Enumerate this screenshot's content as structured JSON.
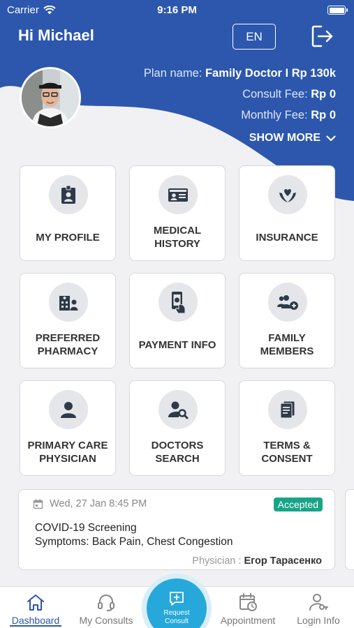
{
  "status_bar": {
    "carrier": "Carrier",
    "time": "9:16 PM"
  },
  "header": {
    "greeting": "Hi Michael",
    "language": "EN",
    "plan_name_label": "Plan name:",
    "plan_name_value": "Family Doctor I Rp 130k",
    "consult_fee_label": "Consult Fee:",
    "consult_fee_value": "Rp 0",
    "monthly_fee_label": "Monthly Fee:",
    "monthly_fee_value": "Rp 0",
    "show_more": "SHOW MORE"
  },
  "tiles": [
    {
      "label": "MY PROFILE",
      "icon": "id-badge-icon"
    },
    {
      "label": "MEDICAL HISTORY",
      "icon": "id-card-icon"
    },
    {
      "label": "INSURANCE",
      "icon": "hand-heart-icon"
    },
    {
      "label": "PREFERRED PHARMACY",
      "icon": "hospital-building-icon"
    },
    {
      "label": "PAYMENT INFO",
      "icon": "phone-payment-icon"
    },
    {
      "label": "FAMILY MEMBERS",
      "icon": "users-add-icon"
    },
    {
      "label": "PRIMARY CARE PHYSICIAN",
      "icon": "user-icon"
    },
    {
      "label": "DOCTORS SEARCH",
      "icon": "user-search-icon"
    },
    {
      "label": "TERMS & CONSENT",
      "icon": "documents-icon"
    }
  ],
  "appointment": {
    "date": "Wed, 27 Jan 8:45 PM",
    "status": "Accepted",
    "title": "COVID-19 Screening",
    "symptoms": "Symptoms: Back Pain, Chest Congestion",
    "physician_label": "Physician :",
    "physician_name": "Егор Тарасенко"
  },
  "tabbar": {
    "dashboard": "Dashboard",
    "my_consults": "My Consults",
    "request_consult_line1": "Request",
    "request_consult_line2": "Consult",
    "appointment": "Appointment",
    "login_info": "Login Info"
  },
  "colors": {
    "primary": "#2c57ad",
    "accent": "#26a8db",
    "accepted": "#18a487"
  }
}
